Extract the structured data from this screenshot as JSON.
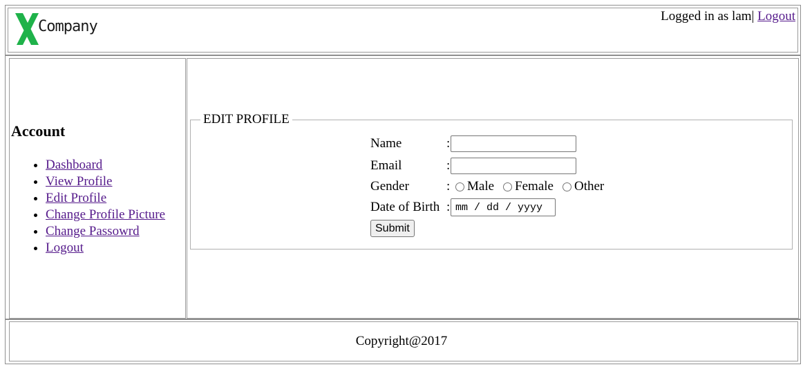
{
  "header": {
    "logo_text": "Company",
    "logged_in_prefix": "Logged in as lam|",
    "logout_label": "Logout"
  },
  "sidebar": {
    "heading": "Account",
    "items": [
      {
        "label": "Dashboard"
      },
      {
        "label": "View Profile"
      },
      {
        "label": "Edit Profile"
      },
      {
        "label": "Change Profile Picture"
      },
      {
        "label": "Change Passowrd"
      },
      {
        "label": "Logout"
      }
    ]
  },
  "form": {
    "legend": "EDIT PROFILE",
    "name_label": "Name",
    "name_value": "",
    "email_label": "Email",
    "email_value": "",
    "gender_label": "Gender",
    "gender_options": [
      "Male",
      "Female",
      "Other"
    ],
    "dob_label": "Date of Birth",
    "dob_placeholder": "mm / dd / yyyy",
    "colon": ":",
    "submit_label": "Submit"
  },
  "footer": {
    "copyright": "Copyright@2017"
  },
  "colors": {
    "logo_green": "#1fb24a",
    "link": "#551a8b",
    "border": "#9a9a9a"
  }
}
